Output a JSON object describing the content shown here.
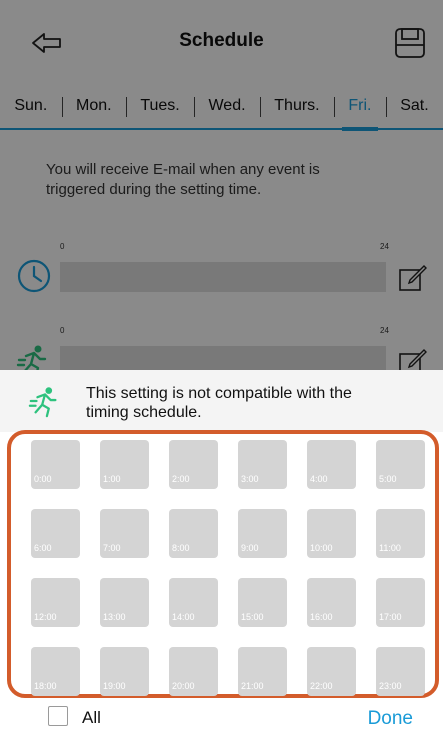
{
  "header": {
    "title": "Schedule",
    "back_icon": "back-arrow-icon",
    "save_icon": "save-icon"
  },
  "days": [
    {
      "label": "Sun.",
      "active": false
    },
    {
      "label": "Mon.",
      "active": false
    },
    {
      "label": "Tues.",
      "active": false
    },
    {
      "label": "Wed.",
      "active": false
    },
    {
      "label": "Thurs.",
      "active": false
    },
    {
      "label": "Fri.",
      "active": true
    },
    {
      "label": "Sat.",
      "active": false
    }
  ],
  "notice": "You will receive E-mail when any event is triggered during the setting time.",
  "rows": [
    {
      "icon": "clock-icon",
      "start_label": "0",
      "end_label": "24"
    },
    {
      "icon": "motion-icon",
      "start_label": "0",
      "end_label": "24"
    }
  ],
  "sheet": {
    "message": "This setting is not compatible with the timing schedule.",
    "message_icon": "motion-icon",
    "hours": [
      "0:00",
      "1:00",
      "2:00",
      "3:00",
      "4:00",
      "5:00",
      "6:00",
      "7:00",
      "8:00",
      "9:00",
      "10:00",
      "11:00",
      "12:00",
      "13:00",
      "14:00",
      "15:00",
      "16:00",
      "17:00",
      "18:00",
      "19:00",
      "20:00",
      "21:00",
      "22:00",
      "23:00"
    ],
    "all_label": "All",
    "all_checked": false,
    "done_label": "Done"
  },
  "colors": {
    "accent": "#1a9bd7",
    "highlight_frame": "#d35c2b",
    "slot": "#d4d4d4",
    "motion": "#2ec27e"
  }
}
